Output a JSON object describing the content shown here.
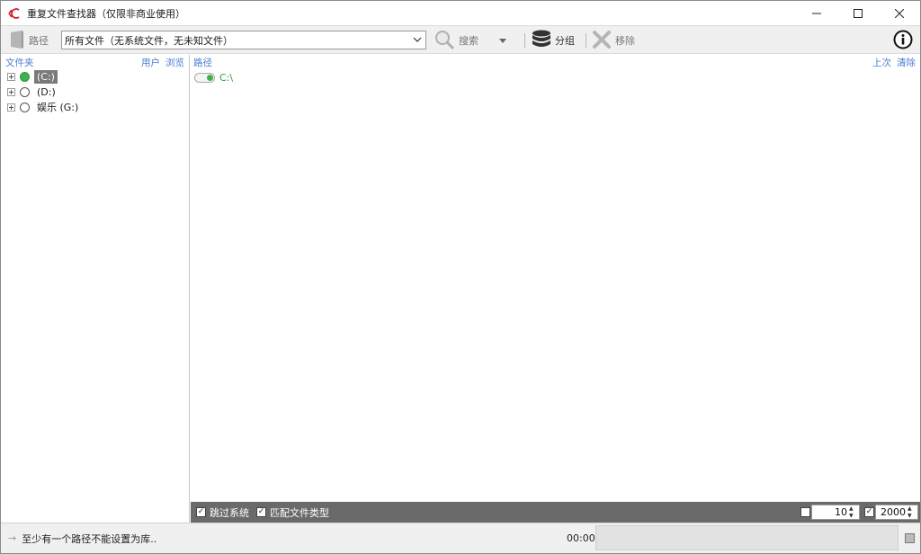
{
  "window": {
    "title": "重复文件查找器（仅限非商业使用）",
    "controls": {
      "minimize": "—",
      "maximize": "☐",
      "close": "✕"
    }
  },
  "toolbar": {
    "path_label": "路径",
    "filter_value": "所有文件（无系统文件，无未知文件）",
    "search_label": "搜索",
    "group_label": "分组",
    "remove_label": "移除"
  },
  "left_pane": {
    "header": "文件夹",
    "links": [
      "用户",
      "浏览"
    ],
    "drives": [
      {
        "label": "(C:)",
        "active": true,
        "selected": true
      },
      {
        "label": "(D:)",
        "active": false,
        "selected": false
      },
      {
        "label": "娱乐 (G:)",
        "active": false,
        "selected": false
      }
    ]
  },
  "right_pane": {
    "header": "路径",
    "links": [
      "上次",
      "清除"
    ],
    "paths": [
      {
        "path": "C:\\",
        "enabled": true
      }
    ]
  },
  "options": {
    "skip_system": {
      "label": "跳过系统",
      "checked": true
    },
    "match_type": {
      "label": "匹配文件类型",
      "checked": true
    },
    "min_enabled": false,
    "min_value": "10",
    "max_enabled": true,
    "max_value": "2000"
  },
  "status": {
    "message": "至少有一个路径不能设置为库..",
    "time": "00:00",
    "progress_percent": 0
  },
  "colors": {
    "link_blue": "#4a7dd1",
    "active_green": "#3fb04a",
    "path_green": "#3c9a3c",
    "options_bg": "#6a6a6a"
  }
}
